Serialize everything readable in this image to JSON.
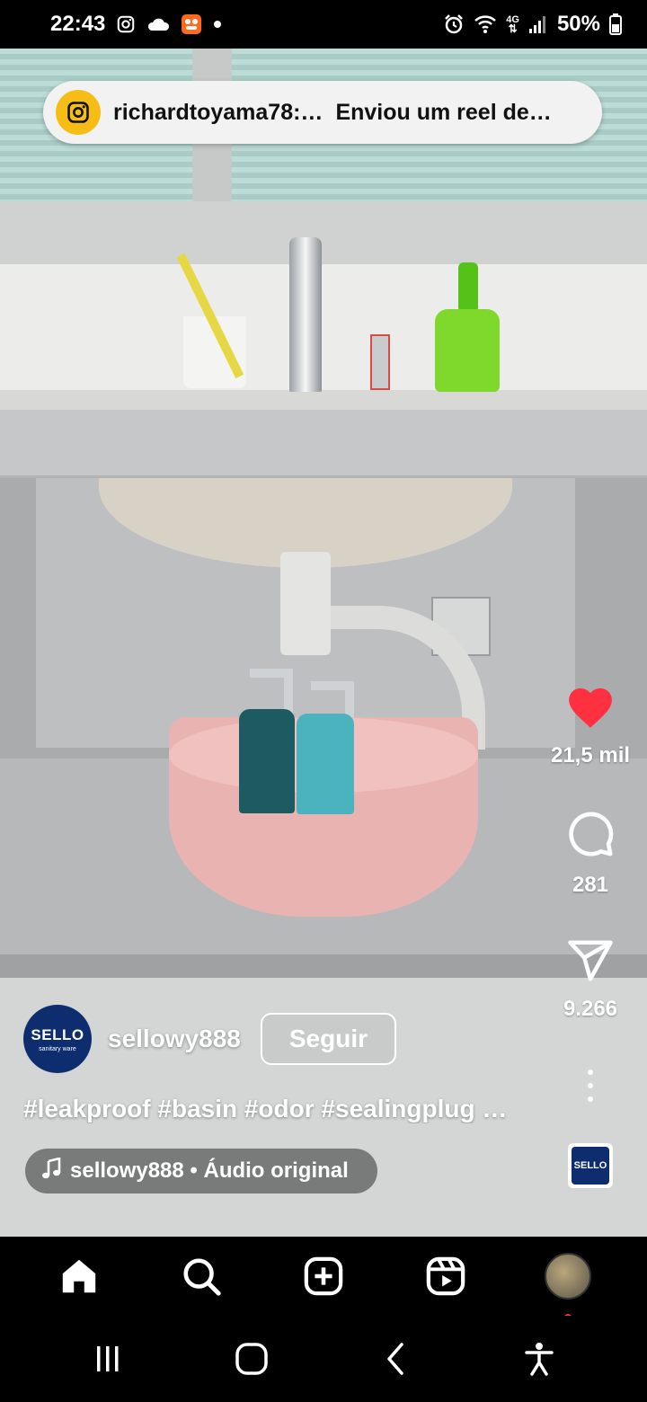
{
  "status_bar": {
    "time": "22:43",
    "battery": "50%",
    "network": "4G",
    "icons_left": [
      "instagram-icon",
      "cloud-icon",
      "app-icon",
      "dot-icon"
    ],
    "icons_right": [
      "alarm-icon",
      "wifi-icon",
      "signal-icon",
      "battery-icon"
    ]
  },
  "notification": {
    "sender": "richardtoyama78:…",
    "text": "Enviou um reel de…",
    "icon": "instagram-icon"
  },
  "reel": {
    "likes": "21,5 mil",
    "comments": "281",
    "shares": "9.266",
    "author": {
      "username": "sellowy888",
      "avatar_brand": "SELLO",
      "avatar_sub": "sanitary ware"
    },
    "follow_label": "Seguir",
    "caption": "#leakproof #basin #odor #sealingplug …",
    "audio": "sellowy888 • Áudio original",
    "audio_thumb_label": "SELLO"
  },
  "colors": {
    "like": "#ff3040",
    "brand_blue": "#0d2d6e",
    "notif_icon_bg": "#f5bd16"
  },
  "bottom_nav": [
    "home-icon",
    "search-icon",
    "create-icon",
    "reels-icon",
    "profile-avatar"
  ],
  "system_nav": [
    "recents-icon",
    "home-button",
    "back-icon",
    "accessibility-icon"
  ]
}
